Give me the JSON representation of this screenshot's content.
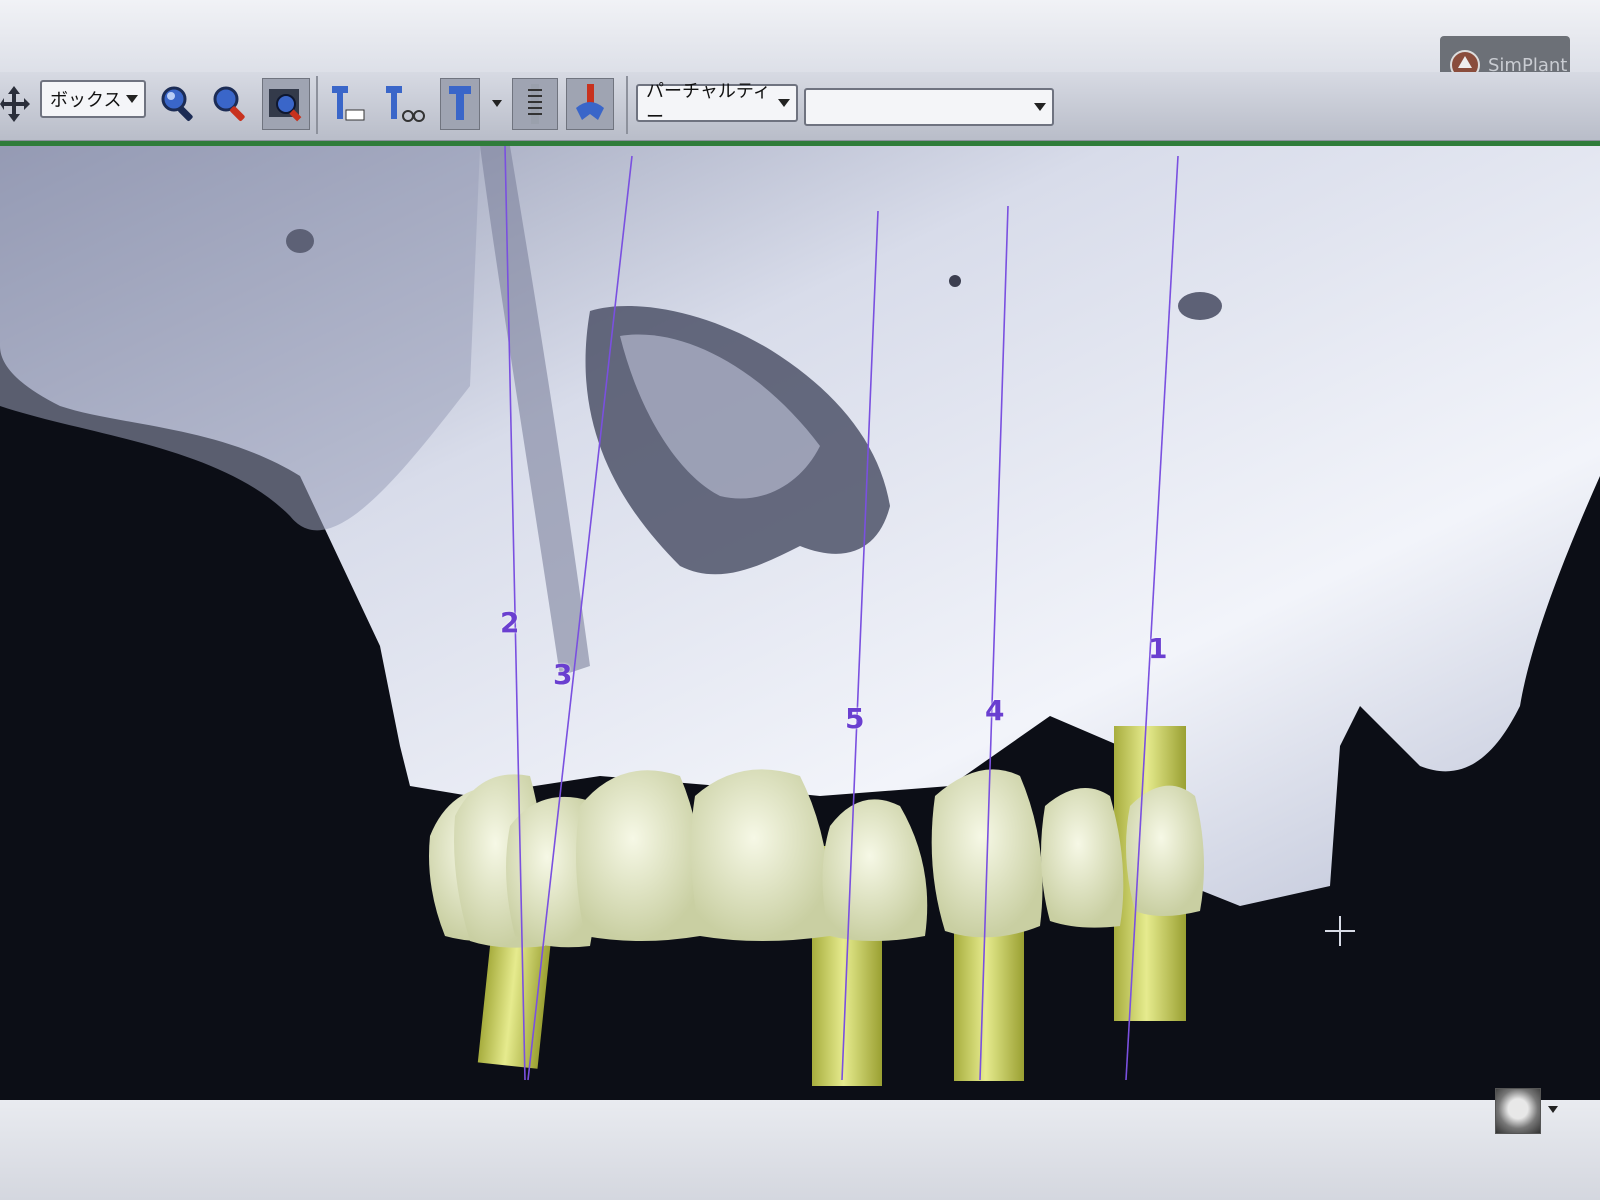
{
  "toolbar": {
    "view_mode": "ボックス",
    "partial_label": "パーチャルティー",
    "second_select": ""
  },
  "brand": {
    "name": "SimPlant"
  },
  "implants": [
    {
      "id": "implant-2",
      "label": "2"
    },
    {
      "id": "implant-3",
      "label": "3"
    },
    {
      "id": "implant-5",
      "label": "5"
    },
    {
      "id": "implant-4",
      "label": "4"
    },
    {
      "id": "implant-1",
      "label": "1"
    }
  ],
  "icons": [
    "move-icon",
    "zoom-icon",
    "zoom-out-icon",
    "view-fit-icon",
    "implant-tool-icon",
    "implant-tool-2-icon",
    "implant-select-icon",
    "screw-icon",
    "tooth-icon",
    "crosshair-icon"
  ],
  "colors": {
    "bone": "#e6e9f4",
    "tooth": "#e6ebc9",
    "implant": "#d8e070",
    "axis": "#7a50e0",
    "green_line": "#2f7c3a"
  }
}
